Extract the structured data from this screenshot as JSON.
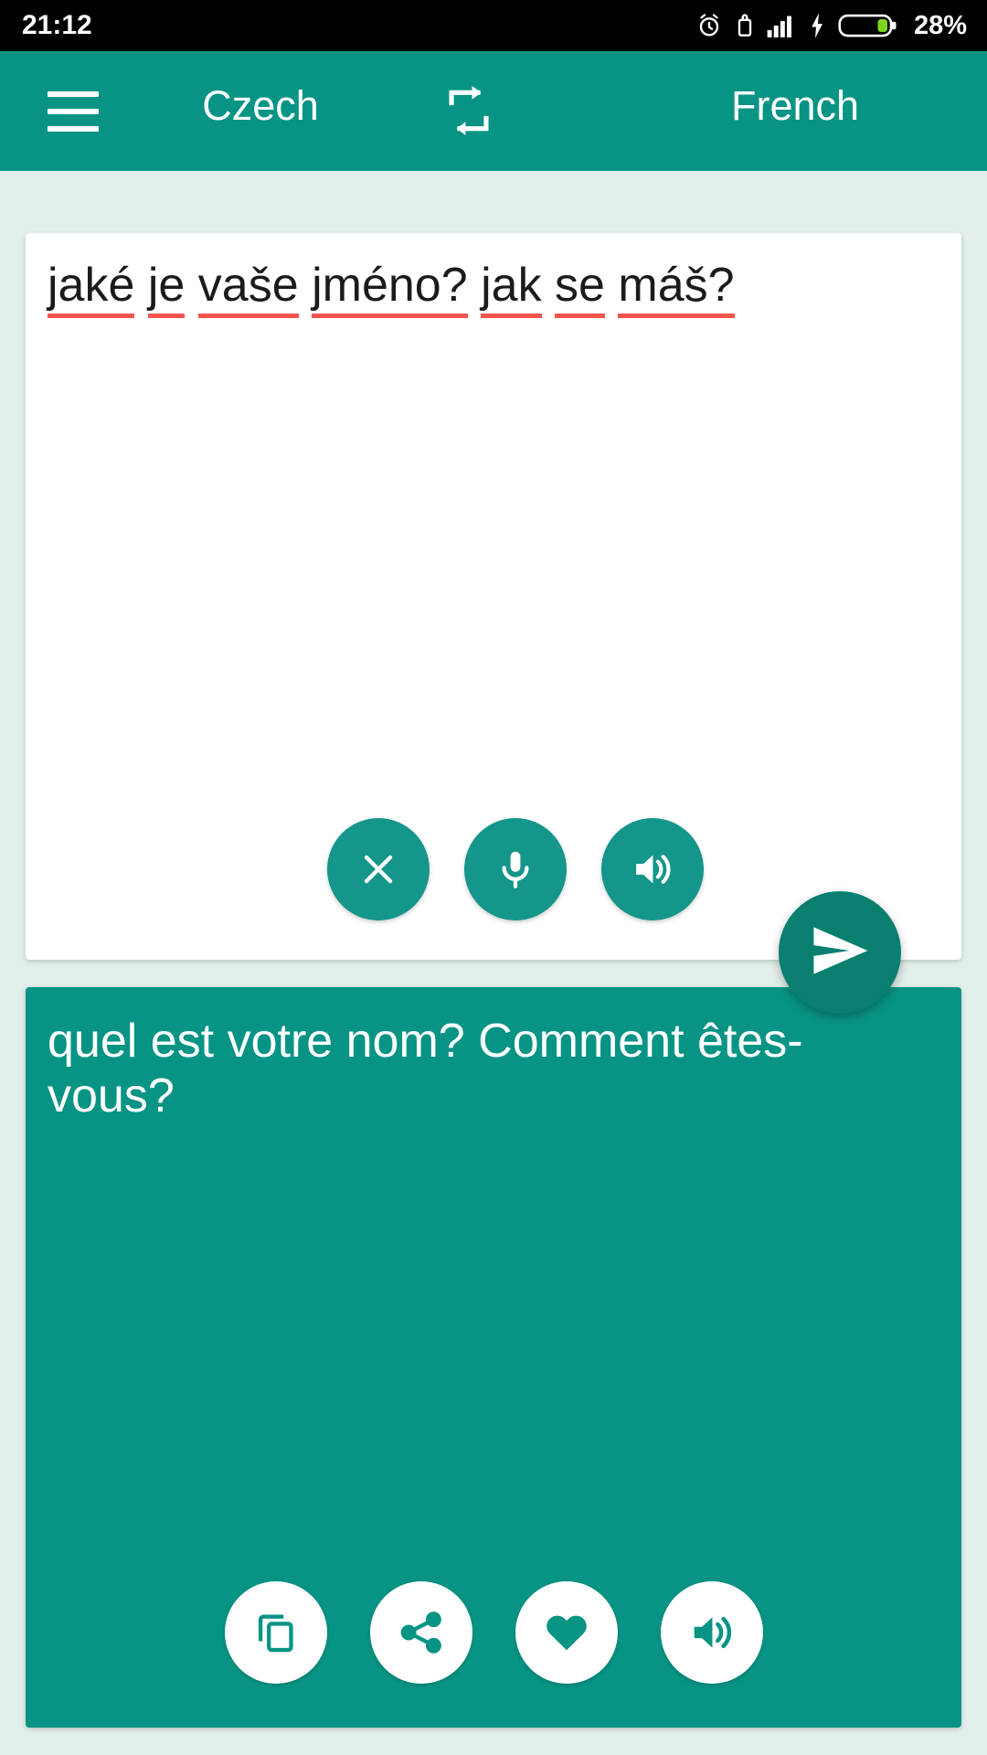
{
  "status_bar": {
    "time": "21:12",
    "battery_percent": "28%",
    "icons": [
      "alarm-icon",
      "usb-lock-icon",
      "signal-bars-icon",
      "charging-bolt-icon",
      "battery-icon"
    ]
  },
  "toolbar": {
    "menu_label": "menu",
    "source_language": "Czech",
    "target_language": "French",
    "swap_label": "swap-languages"
  },
  "input_card": {
    "text": "jaké je vaše jméno? jak se máš?",
    "words": [
      {
        "text": "jaké",
        "misspelled": true
      },
      {
        "text": "je",
        "misspelled": true
      },
      {
        "text": "vaše",
        "misspelled": true
      },
      {
        "text": "jméno?",
        "misspelled": true
      },
      {
        "text": "jak",
        "misspelled": true
      },
      {
        "text": "se",
        "misspelled": true
      },
      {
        "text": "máš?",
        "misspelled": true
      }
    ],
    "actions": [
      {
        "name": "clear-button",
        "icon": "close-icon"
      },
      {
        "name": "voice-input-button",
        "icon": "microphone-icon"
      },
      {
        "name": "speak-source-button",
        "icon": "speaker-icon"
      }
    ]
  },
  "send_button": {
    "label": "send",
    "icon": "send-icon"
  },
  "output_card": {
    "text": "quel est votre nom? Comment êtes-vous?",
    "actions": [
      {
        "name": "copy-button",
        "icon": "copy-icon"
      },
      {
        "name": "share-button",
        "icon": "share-icon"
      },
      {
        "name": "favorite-button",
        "icon": "heart-icon"
      },
      {
        "name": "speak-translation-button",
        "icon": "speaker-icon"
      }
    ]
  },
  "colors": {
    "primary_teal": "#089484",
    "button_teal": "#14968a",
    "fab_teal": "#0a7f70",
    "page_background": "#e2efeb",
    "spellcheck_red": "#f4544a"
  }
}
